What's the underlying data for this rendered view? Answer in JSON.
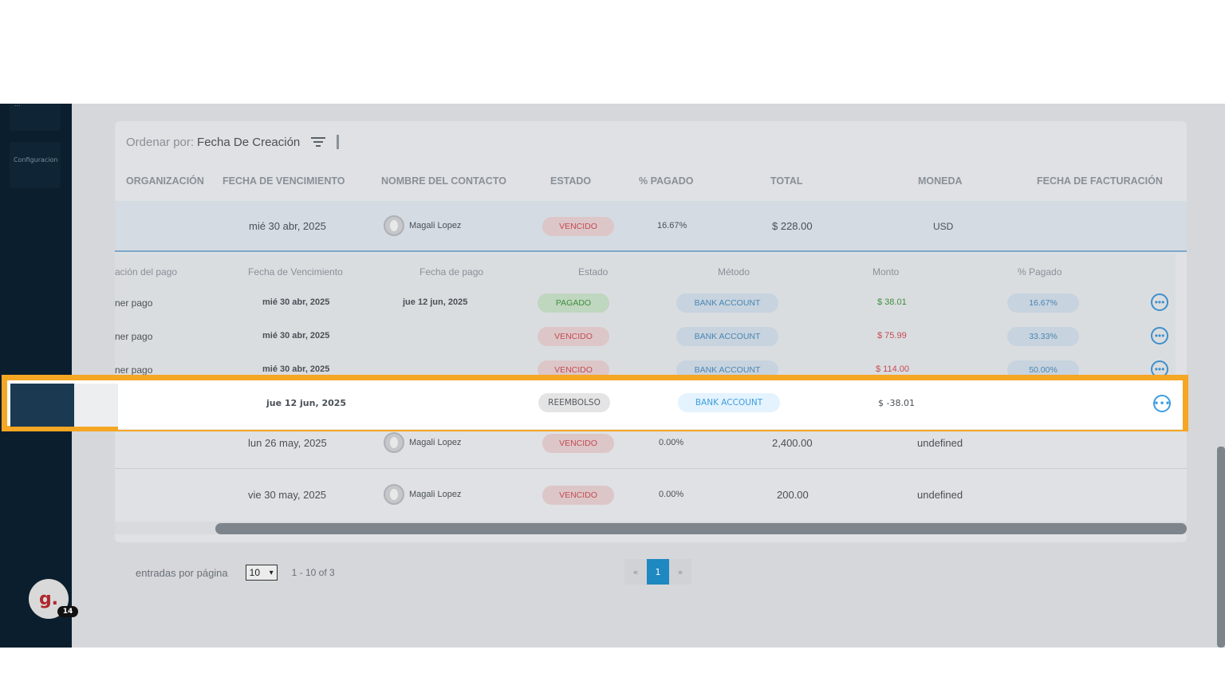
{
  "sidebar": {
    "item_top_label": "...",
    "item_config_label": "Configuracion"
  },
  "avatar": {
    "letter": "g.",
    "badge": "14"
  },
  "sort": {
    "label": "Ordenar por:",
    "value": "Fecha De Creación"
  },
  "columns": [
    "ORGANIZACIÓN",
    "FECHA DE VENCIMIENTO",
    "NOMBRE DEL CONTACTO",
    "ESTADO",
    "% PAGADO",
    "TOTAL",
    "MONEDA",
    "FECHA DE FACTURACIÓN"
  ],
  "invoice": {
    "due_date": "mié 30 abr, 2025",
    "contact": "Magali Lopez",
    "status": "VENCIDO",
    "paid_pct": "16.67%",
    "total": "$ 228.00",
    "currency": "USD"
  },
  "sub_columns": [
    "ación del pago",
    "Fecha de Vencimiento",
    "Fecha de pago",
    "Estado",
    "Método",
    "Monto",
    "% Pagado"
  ],
  "payments": [
    {
      "desc": "ner pago",
      "due": "mié 30 abr, 2025",
      "paid": "jue 12 jun, 2025",
      "status": "PAGADO",
      "method": "BANK ACCOUNT",
      "amount": "$ 38.01",
      "pct": "16.67%"
    },
    {
      "desc": "ner pago",
      "due": "mié 30 abr, 2025",
      "paid": "",
      "status": "VENCIDO",
      "method": "BANK ACCOUNT",
      "amount": "$ 75.99",
      "pct": "33.33%"
    },
    {
      "desc": "ner pago",
      "due": "mié 30 abr, 2025",
      "paid": "",
      "status": "VENCIDO",
      "method": "BANK ACCOUNT",
      "amount": "$ 114.00",
      "pct": "50.00%"
    }
  ],
  "refund": {
    "date": "jue 12 jun, 2025",
    "status": "REEMBOLSO",
    "method": "BANK ACCOUNT",
    "amount": "$ -38.01"
  },
  "invoices_more": [
    {
      "due_date": "lun 26 may, 2025",
      "contact": "Magali Lopez",
      "status": "VENCIDO",
      "paid_pct": "0.00%",
      "total": "2,400.00",
      "currency": "undefined"
    },
    {
      "due_date": "vie 30 may, 2025",
      "contact": "Magali Lopez",
      "status": "VENCIDO",
      "paid_pct": "0.00%",
      "total": "200.00",
      "currency": "undefined"
    }
  ],
  "footer": {
    "per_page_label": "entradas por página",
    "per_page_value": "10",
    "range": "1 - 10 of 3"
  },
  "pager": {
    "prev": "«",
    "current": "1",
    "next": "»"
  },
  "colors": {
    "highlight": "#f5a623",
    "sidebar": "#0b1e2e",
    "accent": "#1e88c0"
  }
}
